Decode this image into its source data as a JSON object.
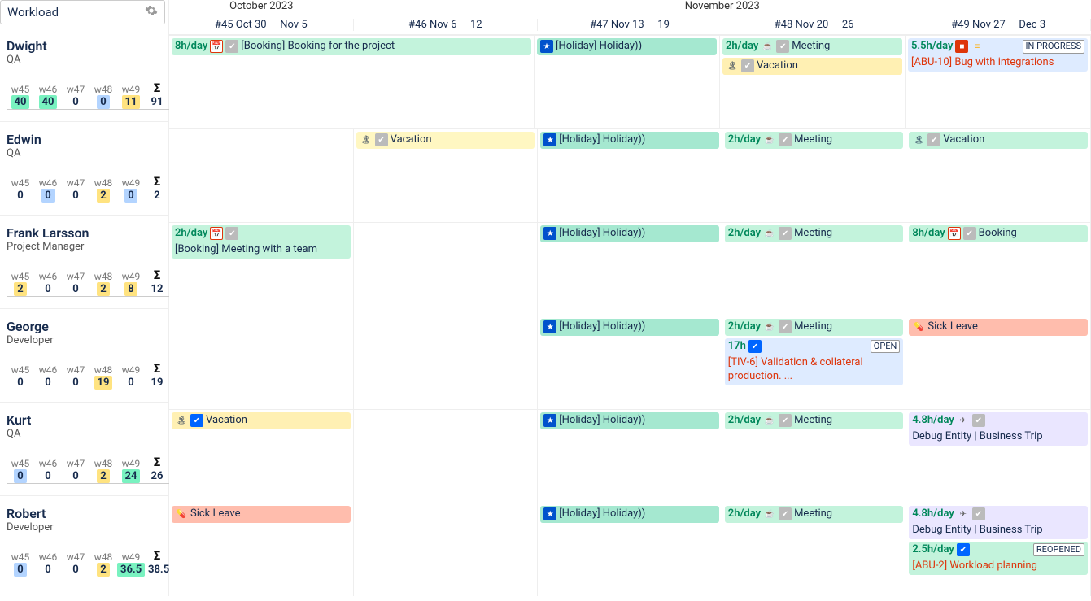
{
  "sidebar": {
    "title": "Workload",
    "people": [
      {
        "name": "Dwight",
        "role": "QA",
        "weeks": [
          {
            "label": "w45",
            "value": "40",
            "hl": "hl-green"
          },
          {
            "label": "w46",
            "value": "40",
            "hl": "hl-green"
          },
          {
            "label": "w47",
            "value": "0",
            "hl": ""
          },
          {
            "label": "w48",
            "value": "0",
            "hl": "hl-blue"
          },
          {
            "label": "w49",
            "value": "11",
            "hl": "hl-yellow"
          }
        ],
        "total": "91"
      },
      {
        "name": "Edwin",
        "role": "QA",
        "weeks": [
          {
            "label": "w45",
            "value": "0",
            "hl": ""
          },
          {
            "label": "w46",
            "value": "0",
            "hl": "hl-blue"
          },
          {
            "label": "w47",
            "value": "0",
            "hl": ""
          },
          {
            "label": "w48",
            "value": "2",
            "hl": "hl-yellow"
          },
          {
            "label": "w49",
            "value": "0",
            "hl": "hl-blue"
          }
        ],
        "total": "2"
      },
      {
        "name": "Frank Larsson",
        "role": "Project Manager",
        "weeks": [
          {
            "label": "w45",
            "value": "2",
            "hl": "hl-yellow"
          },
          {
            "label": "w46",
            "value": "0",
            "hl": ""
          },
          {
            "label": "w47",
            "value": "0",
            "hl": ""
          },
          {
            "label": "w48",
            "value": "2",
            "hl": "hl-yellow"
          },
          {
            "label": "w49",
            "value": "8",
            "hl": "hl-yellow"
          }
        ],
        "total": "12"
      },
      {
        "name": "George",
        "role": "Developer",
        "weeks": [
          {
            "label": "w45",
            "value": "0",
            "hl": ""
          },
          {
            "label": "w46",
            "value": "0",
            "hl": ""
          },
          {
            "label": "w47",
            "value": "0",
            "hl": ""
          },
          {
            "label": "w48",
            "value": "19",
            "hl": "hl-yellow"
          },
          {
            "label": "w49",
            "value": "0",
            "hl": ""
          }
        ],
        "total": "19"
      },
      {
        "name": "Kurt",
        "role": "QA",
        "weeks": [
          {
            "label": "w45",
            "value": "0",
            "hl": "hl-blue"
          },
          {
            "label": "w46",
            "value": "0",
            "hl": ""
          },
          {
            "label": "w47",
            "value": "0",
            "hl": ""
          },
          {
            "label": "w48",
            "value": "2",
            "hl": "hl-yellow"
          },
          {
            "label": "w49",
            "value": "24",
            "hl": "hl-green"
          }
        ],
        "total": "26"
      },
      {
        "name": "Robert",
        "role": "Developer",
        "weeks": [
          {
            "label": "w45",
            "value": "0",
            "hl": "hl-blue"
          },
          {
            "label": "w46",
            "value": "0",
            "hl": ""
          },
          {
            "label": "w47",
            "value": "0",
            "hl": ""
          },
          {
            "label": "w48",
            "value": "2",
            "hl": "hl-yellow"
          },
          {
            "label": "w49",
            "value": "36.5",
            "hl": "hl-green"
          }
        ],
        "total": "38.5"
      }
    ]
  },
  "timeline": {
    "months": [
      "October 2023",
      "November 2023"
    ],
    "weeks": [
      "#45 Oct 30 — Nov 5",
      "#46 Nov 6 — 12",
      "#47 Nov 13 — 19",
      "#48 Nov 20 — 26",
      "#49 Nov 27 — Dec 3"
    ]
  },
  "cards": {
    "dwight": {
      "w45": {
        "hours": "8h/day",
        "title": "[Booking] Booking for the project",
        "bg": "bg-green",
        "icons": [
          "cal",
          "check"
        ]
      },
      "w47": {
        "title": "[Holiday] Holiday))",
        "bg": "bg-teal",
        "icons": [
          "star"
        ]
      },
      "w48a": {
        "hours": "2h/day",
        "title": "Meeting",
        "bg": "bg-green",
        "icons": [
          "coffee",
          "check"
        ]
      },
      "w48b": {
        "title": "Vacation",
        "bg": "bg-yellow",
        "icons": [
          "palm",
          "check"
        ]
      },
      "w49": {
        "hours": "5.5h/day",
        "title": "[ABU-10] Bug with integrations",
        "bg": "bg-blue",
        "badge": "IN PROGRESS",
        "icons": [
          "block",
          "bars"
        ],
        "titleRed": true
      }
    },
    "edwin": {
      "w46": {
        "title": "Vacation",
        "bg": "bg-yellow2",
        "icons": [
          "palm",
          "check"
        ]
      },
      "w47": {
        "title": "[Holiday] Holiday))",
        "bg": "bg-teal",
        "icons": [
          "star"
        ]
      },
      "w48": {
        "hours": "2h/day",
        "title": "Meeting",
        "bg": "bg-green",
        "icons": [
          "coffee",
          "check"
        ]
      },
      "w49": {
        "title": "Vacation",
        "bg": "bg-green",
        "icons": [
          "palm",
          "check"
        ]
      }
    },
    "frank": {
      "w45": {
        "hours": "2h/day",
        "title": "[Booking] Meeting with a team",
        "bg": "bg-green",
        "icons": [
          "cal",
          "check"
        ]
      },
      "w47": {
        "title": "[Holiday] Holiday))",
        "bg": "bg-teal",
        "icons": [
          "star"
        ]
      },
      "w48": {
        "hours": "2h/day",
        "title": "Meeting",
        "bg": "bg-green",
        "icons": [
          "coffee",
          "check"
        ]
      },
      "w49": {
        "hours": "8h/day",
        "title": "Booking",
        "bg": "bg-green",
        "icons": [
          "cal",
          "check"
        ]
      }
    },
    "george": {
      "w47": {
        "title": "[Holiday] Holiday))",
        "bg": "bg-teal",
        "icons": [
          "star"
        ]
      },
      "w48a": {
        "hours": "2h/day",
        "title": "Meeting",
        "bg": "bg-green",
        "icons": [
          "coffee",
          "check"
        ]
      },
      "w48b": {
        "hours": "17h",
        "title": "[TIV-6] Validation & collateral production. ...",
        "bg": "bg-blue",
        "badge": "OPEN",
        "icons": [
          "checkb"
        ],
        "titleRed": true
      },
      "w49": {
        "title": "Sick Leave",
        "bg": "bg-pink",
        "icons": [
          "pill"
        ]
      }
    },
    "kurt": {
      "w45": {
        "title": "Vacation",
        "bg": "bg-yellow",
        "icons": [
          "palm",
          "checkb"
        ]
      },
      "w47": {
        "title": "[Holiday] Holiday))",
        "bg": "bg-teal",
        "icons": [
          "star"
        ]
      },
      "w48": {
        "hours": "2h/day",
        "title": "Meeting",
        "bg": "bg-green",
        "icons": [
          "coffee",
          "check"
        ]
      },
      "w49": {
        "hours": "4.8h/day",
        "title": "Debug Entity | Business Trip",
        "bg": "bg-purple",
        "icons": [
          "plane",
          "check"
        ]
      }
    },
    "robert": {
      "w45": {
        "title": "Sick Leave",
        "bg": "bg-pink",
        "icons": [
          "pill"
        ]
      },
      "w47": {
        "title": "[Holiday] Holiday))",
        "bg": "bg-teal",
        "icons": [
          "star"
        ]
      },
      "w48": {
        "hours": "2h/day",
        "title": "Meeting",
        "bg": "bg-green",
        "icons": [
          "coffee",
          "check"
        ]
      },
      "w49a": {
        "hours": "4.8h/day",
        "title": "Debug Entity | Business Trip",
        "bg": "bg-purple",
        "icons": [
          "plane",
          "check"
        ]
      },
      "w49b": {
        "hours": "2.5h/day",
        "title": "[ABU-2] Workload planning",
        "bg": "bg-green",
        "badge": "REOPENED",
        "icons": [
          "checkb"
        ],
        "titleRed": true
      }
    }
  }
}
